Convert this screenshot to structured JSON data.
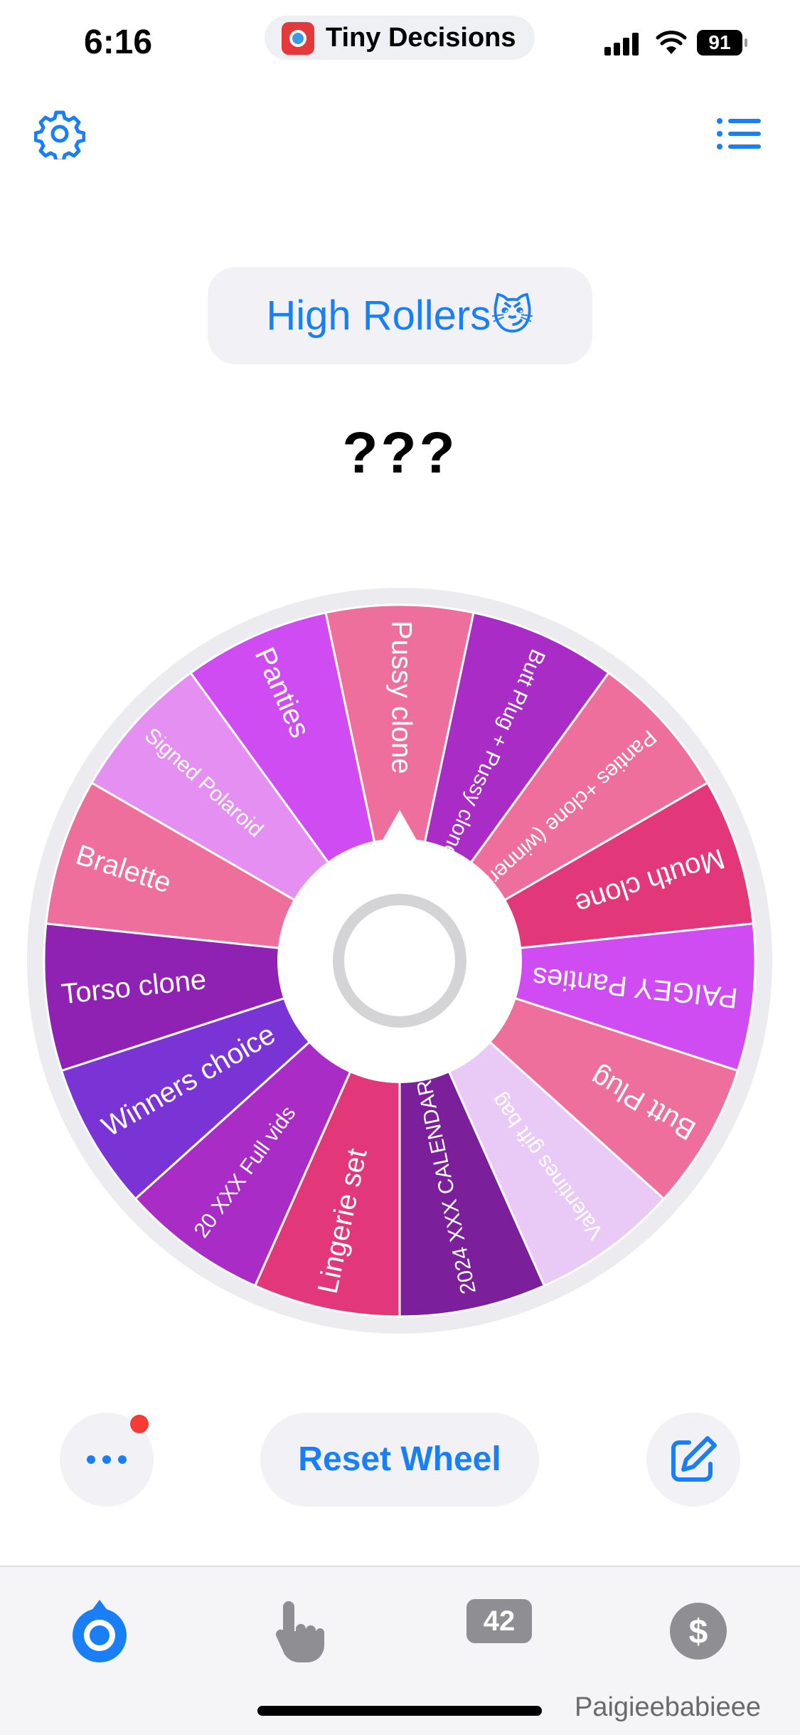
{
  "status_bar": {
    "time": "6:16",
    "app_name": "Tiny Decisions",
    "battery": "91"
  },
  "wheel_title": "High Rollers😼",
  "result_text": "???",
  "wheel": {
    "segments": [
      {
        "label": "Pussy clone",
        "color": "#ee6f9b"
      },
      {
        "label": "Butt Plug + Pussy clone",
        "color": "#a92cc6"
      },
      {
        "label": "Panties +clone (winners choice)",
        "color": "#ee6f9b"
      },
      {
        "label": "Mouth clone",
        "color": "#e2387a"
      },
      {
        "label": "PAIGEY Panties",
        "color": "#cf4cf2"
      },
      {
        "label": "Butt Plug",
        "color": "#ee6f9b"
      },
      {
        "label": "Valentines gift bag",
        "color": "#e9c9f6"
      },
      {
        "label": "2024 XXX CALENDAR",
        "color": "#7b209a"
      },
      {
        "label": "Lingerie set",
        "color": "#e2387a"
      },
      {
        "label": "20 XXX Full vids",
        "color": "#a92cc6"
      },
      {
        "label": "Winners choice",
        "color": "#7a34d6"
      },
      {
        "label": "Torso clone",
        "color": "#8f22b3"
      },
      {
        "label": "Bralette",
        "color": "#ee6f9b"
      },
      {
        "label": "Signed Polaroid",
        "color": "#e58ff2"
      },
      {
        "label": "Panties",
        "color": "#cf4cf2"
      }
    ]
  },
  "buttons": {
    "reset": "Reset Wheel"
  },
  "tab_bar": {
    "count": "42"
  },
  "watermark": "Paigieebabieee",
  "colors": {
    "accent": "#1a7ef5",
    "badge": "#f43c34",
    "tab_inactive": "#8e8e93"
  }
}
